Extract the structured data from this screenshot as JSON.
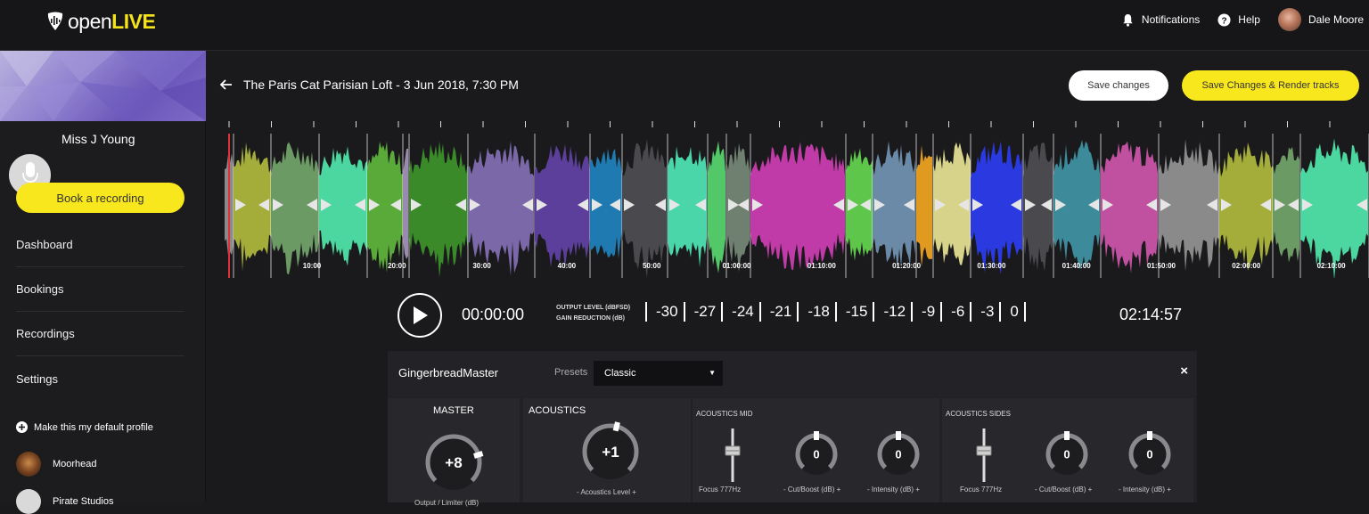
{
  "brand": {
    "name_open": "open",
    "name_live": "LIVE"
  },
  "topnav": {
    "notifications": "Notifications",
    "help": "Help",
    "user": "Dale Moore"
  },
  "sidebar": {
    "profile_name": "Miss J Young",
    "book_button": "Book a recording",
    "menu": [
      "Dashboard",
      "Bookings",
      "Recordings",
      "Settings"
    ],
    "default_profile": "Make this my default profile",
    "profiles": [
      "Moorhead",
      "Pirate Studios"
    ]
  },
  "header": {
    "title": "The Paris Cat Parisian Loft - 3 Jun 2018, 7:30 PM",
    "save_changes": "Save changes",
    "save_render": "Save Changes & Render tracks"
  },
  "timeline": {
    "labels": [
      "10:00",
      "20:00",
      "30:00",
      "40:00",
      "50:00",
      "01:00:00",
      "01:10:00",
      "01:20:00",
      "01:30:00",
      "01:40:00",
      "01:50:00",
      "02:00:00",
      "02:10:00"
    ]
  },
  "transport": {
    "current_time": "00:00:00",
    "output_label": "OUTPUT LEVEL (dBFSD)",
    "gain_label": "GAIN REDUCTION (dB)",
    "meter_ticks": [
      "-30",
      "-27",
      "-24",
      "-21",
      "-18",
      "-15",
      "-12",
      "-9",
      "-6",
      "-3",
      "0"
    ],
    "total_time": "02:14:57"
  },
  "plugin": {
    "name": "GingerbreadMaster",
    "presets_label": "Presets",
    "preset_value": "Classic",
    "close": "×",
    "master": {
      "title": "MASTER",
      "value": "+8",
      "caption": "Output / Limiter (dB)",
      "level": 0.77
    },
    "acoustics": {
      "title": "ACOUSTICS",
      "value": "+1",
      "caption": "- Acoustics Level +",
      "level": 0.55
    },
    "acoustics_mid": {
      "title": "ACOUSTICS MID",
      "focus_caption": "Focus 777Hz",
      "cut_value": "0",
      "cut_caption": "- Cut/Boost (dB) +",
      "intensity_value": "0",
      "intensity_caption": "- Intensity (dB) +"
    },
    "acoustics_sides": {
      "title": "ACOUSTICS SIDES",
      "focus_caption": "Focus 777Hz",
      "cut_value": "0",
      "cut_caption": "- Cut/Boost (dB) +",
      "intensity_value": "0",
      "intensity_caption": "- Intensity (dB) +"
    }
  },
  "colors": {
    "accent": "#f8e71c",
    "segments": [
      "#8a8a8a",
      "#a4ac3a",
      "#6b9a64",
      "#4cd6a0",
      "#5aaa3a",
      "#9b8ab0",
      "#3a8a2a",
      "#7b68a8",
      "#5b3f9a",
      "#1e7ab0",
      "#4a4a4e",
      "#4ad6a8",
      "#52c868",
      "#6f7f70",
      "#c03aa8",
      "#5ec64a",
      "#6a8aa8",
      "#e09a20",
      "#d8d38a",
      "#2a3ae0",
      "#4a4a4e",
      "#3c8a9a",
      "#c050a0"
    ]
  }
}
